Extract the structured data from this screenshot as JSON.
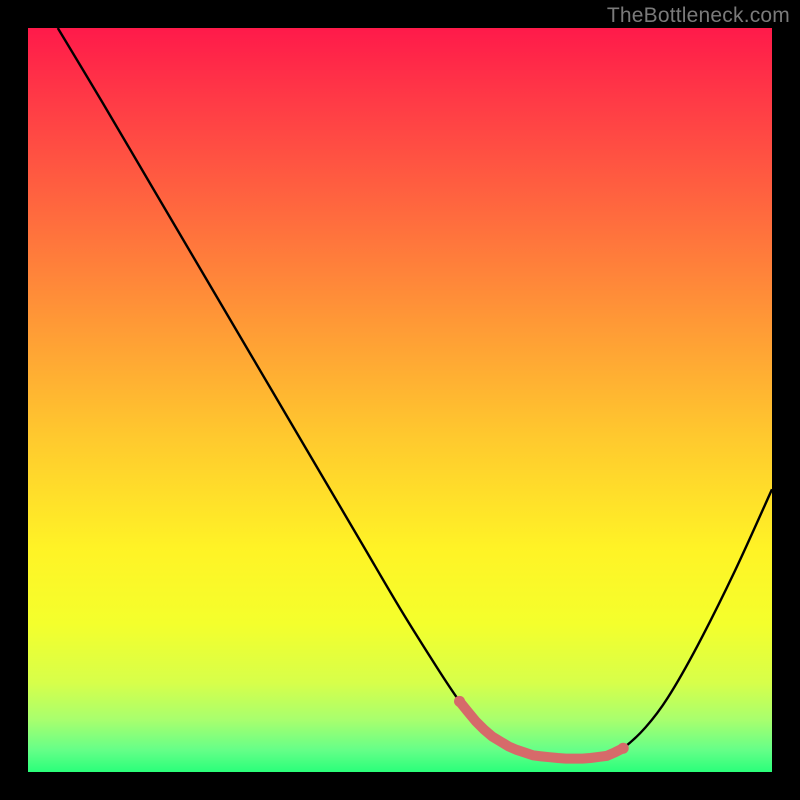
{
  "watermark": "TheBottleneck.com",
  "colors": {
    "frame": "#000000",
    "curve": "#000000",
    "marker": "#d66a6a",
    "gradient_stops": [
      {
        "offset": 0.0,
        "color": "#ff1a4a"
      },
      {
        "offset": 0.1,
        "color": "#ff3b46"
      },
      {
        "offset": 0.25,
        "color": "#ff6a3e"
      },
      {
        "offset": 0.4,
        "color": "#ff9a36"
      },
      {
        "offset": 0.55,
        "color": "#ffc92e"
      },
      {
        "offset": 0.7,
        "color": "#fff326"
      },
      {
        "offset": 0.8,
        "color": "#f4ff2c"
      },
      {
        "offset": 0.88,
        "color": "#d7ff4a"
      },
      {
        "offset": 0.93,
        "color": "#a8ff6e"
      },
      {
        "offset": 0.97,
        "color": "#66ff88"
      },
      {
        "offset": 1.0,
        "color": "#2aff7a"
      }
    ]
  },
  "chart_data": {
    "type": "line",
    "title": "",
    "xlabel": "",
    "ylabel": "",
    "xlim": [
      0,
      100
    ],
    "ylim": [
      0,
      100
    ],
    "series": [
      {
        "name": "bottleneck-curve",
        "x": [
          4,
          10,
          15,
          20,
          25,
          30,
          35,
          40,
          45,
          50,
          55,
          58,
          60,
          62,
          65,
          68,
          72,
          75,
          78,
          80,
          83,
          86,
          90,
          95,
          100
        ],
        "y": [
          100,
          90,
          81.5,
          73,
          64.5,
          56,
          47.5,
          39,
          30.5,
          22,
          14,
          9.5,
          7,
          5,
          3.2,
          2.2,
          1.8,
          1.8,
          2.2,
          3.2,
          6,
          10,
          17,
          27,
          38
        ]
      }
    ],
    "flat_region": {
      "x_start": 58,
      "x_end": 80,
      "y_approx": 3,
      "color": "#d66a6a"
    },
    "annotations": []
  }
}
